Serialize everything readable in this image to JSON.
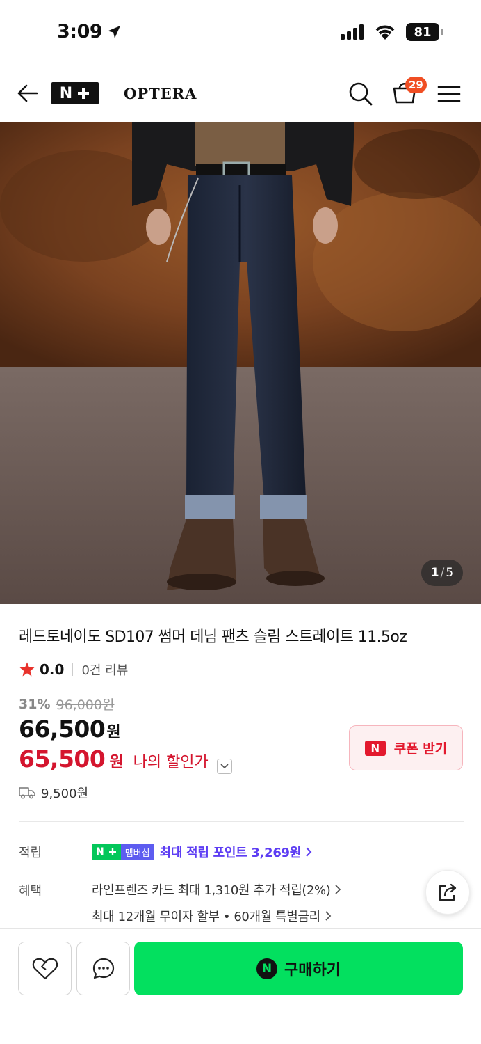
{
  "status_bar": {
    "time": "3:09",
    "battery": "81"
  },
  "header": {
    "brand": "OPTERA",
    "cart_count": "29"
  },
  "gallery": {
    "current": "1",
    "separator": "/",
    "total": "5"
  },
  "product": {
    "title": "레드토네이도 SD107 썸머 데님 팬츠 슬림 스트레이트 11.5oz",
    "rating": "0.0",
    "review_count": "0건 리뷰",
    "discount_pct": "31%",
    "original_price": "96,000원",
    "sale_price": "66,500",
    "sale_price_unit": "원",
    "my_price": "65,500",
    "my_price_unit": "원",
    "my_price_label": "나의 할인가",
    "coupon_label": "쿠폰 받기",
    "shipping_fee": "9,500원"
  },
  "points": {
    "label": "적립",
    "badge_label": "멤버십",
    "text": "최대 적립 포인트 3,269원"
  },
  "benefits": {
    "label": "혜택",
    "lines": [
      "라인프렌즈 카드 최대 1,310원 추가 적립(2%)",
      "최대 12개월 무이자 할부 • 60개월 특별금리"
    ]
  },
  "bottom_bar": {
    "buy_label": "구매하기"
  },
  "colors": {
    "naver_green": "#03e05f",
    "price_red": "#d4152e",
    "points_purple": "#5d3df3",
    "badge_orange": "#f04e23"
  }
}
